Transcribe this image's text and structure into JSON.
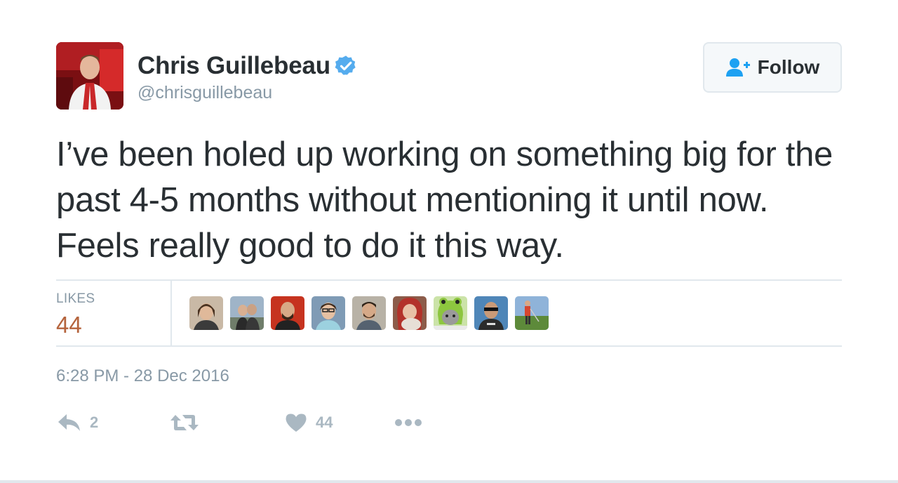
{
  "author": {
    "name": "Chris Guillebeau",
    "handle": "@chrisguillebeau",
    "verified": true,
    "avatar_icon": "profile-photo"
  },
  "follow_button": {
    "label": "Follow",
    "icon": "add-user-icon"
  },
  "tweet": {
    "text": "I’ve been holed up working on something big for the past 4-5 months without mentioning it until now. Feels really good to do it this way."
  },
  "stats": {
    "likes_label": "LIKES",
    "likes_count": "44",
    "liker_count": 9
  },
  "timestamp": "6:28 PM - 28 Dec 2016",
  "actions": {
    "reply_count": "2",
    "retweet_count": "",
    "like_count": "44"
  },
  "colors": {
    "text": "#292f33",
    "muted": "#8899a6",
    "likes_count": "#b5643d",
    "verified_badge": "#1da1f2",
    "follow_icon": "#1da1f2",
    "action_icons": "#aab8c2",
    "border": "#e1e8ed"
  }
}
